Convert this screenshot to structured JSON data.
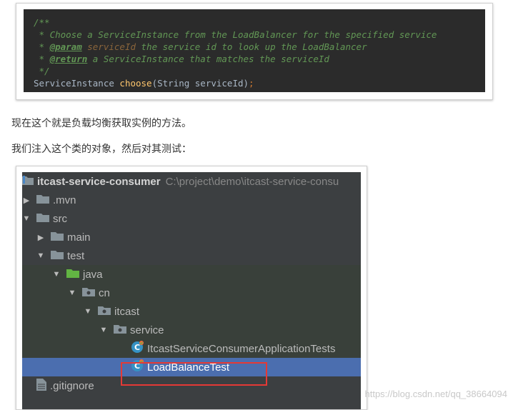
{
  "code": {
    "line1": "/**",
    "line2_star": " * ",
    "line2_text": "Choose a ServiceInstance from the LoadBalancer for the specified service",
    "line3_star": " * ",
    "line3_tag": "@param",
    "line3_param": "serviceId",
    "line3_text": " the service id to look up the LoadBalancer",
    "line4_star": " * ",
    "line4_tag": "@return",
    "line4_text": " a ServiceInstance that matches the serviceId",
    "line5": " */",
    "line6_type": "ServiceInstance ",
    "line6_fn": "choose",
    "line6_args": "(String serviceId)",
    "line6_semi": ";"
  },
  "paragraphs": {
    "p1": "现在这个就是负载均衡获取实例的方法。",
    "p2": "我们注入这个类的对象，然后对其测试："
  },
  "tree": {
    "root_label": "itcast-service-consumer",
    "root_path": "C:\\project\\demo\\itcast-service-consu",
    "items": [
      {
        "label": ".mvn",
        "icon": "folder-icon"
      },
      {
        "label": "src",
        "icon": "folder-icon"
      },
      {
        "label": "main",
        "icon": "folder-icon"
      },
      {
        "label": "test",
        "icon": "folder-icon"
      },
      {
        "label": "java",
        "icon": "test-source-folder-icon"
      },
      {
        "label": "cn",
        "icon": "package-icon"
      },
      {
        "label": "itcast",
        "icon": "package-icon"
      },
      {
        "label": "service",
        "icon": "package-icon"
      },
      {
        "label": "ItcastServiceConsumerApplicationTests",
        "icon": "test-class-icon"
      },
      {
        "label": "LoadBalanceTest",
        "icon": "test-class-icon"
      },
      {
        "label": ".gitignore",
        "icon": "file-icon"
      }
    ]
  },
  "watermark": "https://blog.csdn.net/qq_38664094",
  "colors": {
    "code_bg": "#2b2b2b",
    "tree_bg": "#3c3f41",
    "selection": "#4b6eaf",
    "highlight_box": "#e53935"
  }
}
